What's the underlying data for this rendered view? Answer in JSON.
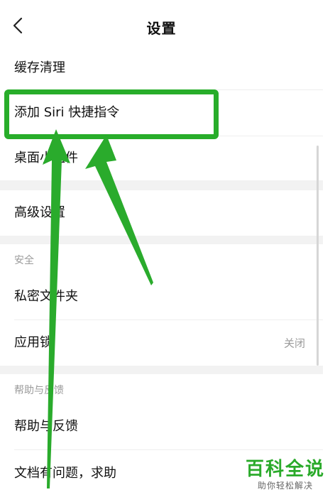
{
  "header": {
    "title": "设置",
    "back_icon": "chevron-left-icon"
  },
  "rows": {
    "cache_clean": "缓存清理",
    "siri_shortcut": "添加 Siri 快捷指令",
    "desktop_widget": "桌面小组件",
    "advanced": "高级设置",
    "private_folder": "私密文件夹",
    "app_lock": "应用锁",
    "app_lock_status": "关闭",
    "help_feedback": "帮助与反馈",
    "doc_issue": "文档有问题，求助"
  },
  "sections": {
    "security": "安全",
    "help": "帮助与反馈"
  },
  "watermark": {
    "main": "百科全说",
    "sub": "助你轻松解决"
  },
  "colors": {
    "annotation_green": "#28ad2a",
    "section_gray": "#f2f2f2",
    "secondary_text": "#9a9a9a"
  }
}
